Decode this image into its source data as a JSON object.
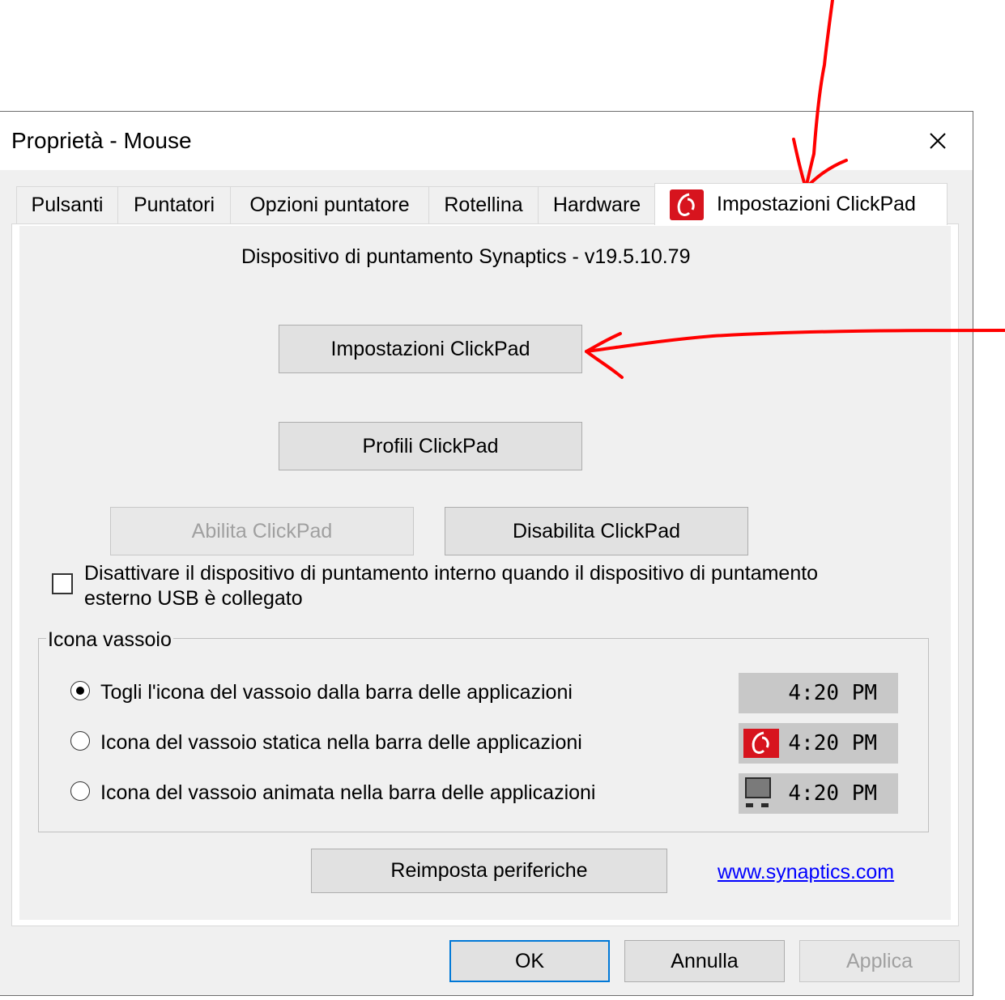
{
  "window": {
    "title": "Proprietà - Mouse"
  },
  "tabs": [
    {
      "label": "Pulsanti"
    },
    {
      "label": "Puntatori"
    },
    {
      "label": "Opzioni puntatore"
    },
    {
      "label": "Rotellina"
    },
    {
      "label": "Hardware"
    },
    {
      "label": "Impostazioni ClickPad",
      "active": true,
      "icon": "synaptics-icon"
    }
  ],
  "panel": {
    "device_caption": "Dispositivo di puntamento Synaptics - v19.5.10.79",
    "buttons": {
      "clickpad_settings": "Impostazioni ClickPad",
      "clickpad_profiles": "Profili ClickPad",
      "enable_clickpad": "Abilita ClickPad",
      "disable_clickpad": "Disabilita ClickPad",
      "reset_devices": "Reimposta periferiche"
    },
    "checkbox": {
      "label_line1": "Disattivare il dispositivo di puntamento interno quando il dispositivo di puntamento",
      "label_line2": "esterno USB è collegato",
      "checked": false
    },
    "tray_group": {
      "label": "Icona vassoio",
      "options": [
        {
          "label": "Togli l'icona del vassoio dalla barra delle applicazioni",
          "selected": true,
          "preview_time": "4:20 PM",
          "preview_icon": "none"
        },
        {
          "label": "Icona del vassoio statica nella barra delle applicazioni",
          "selected": false,
          "preview_time": "4:20 PM",
          "preview_icon": "synaptics-icon"
        },
        {
          "label": "Icona del vassoio animata nella barra delle applicazioni",
          "selected": false,
          "preview_time": "4:20 PM",
          "preview_icon": "touchpad-icon"
        }
      ]
    },
    "link": "www.synaptics.com"
  },
  "footer": {
    "ok": "OK",
    "cancel": "Annulla",
    "apply": "Applica"
  },
  "colors": {
    "accent": "#0078d7",
    "annotation": "#ff0000",
    "synaptics_red": "#d7141e",
    "link": "#0000ff"
  },
  "annotations": [
    "red-arrow-to-tab",
    "red-arrow-to-button"
  ]
}
